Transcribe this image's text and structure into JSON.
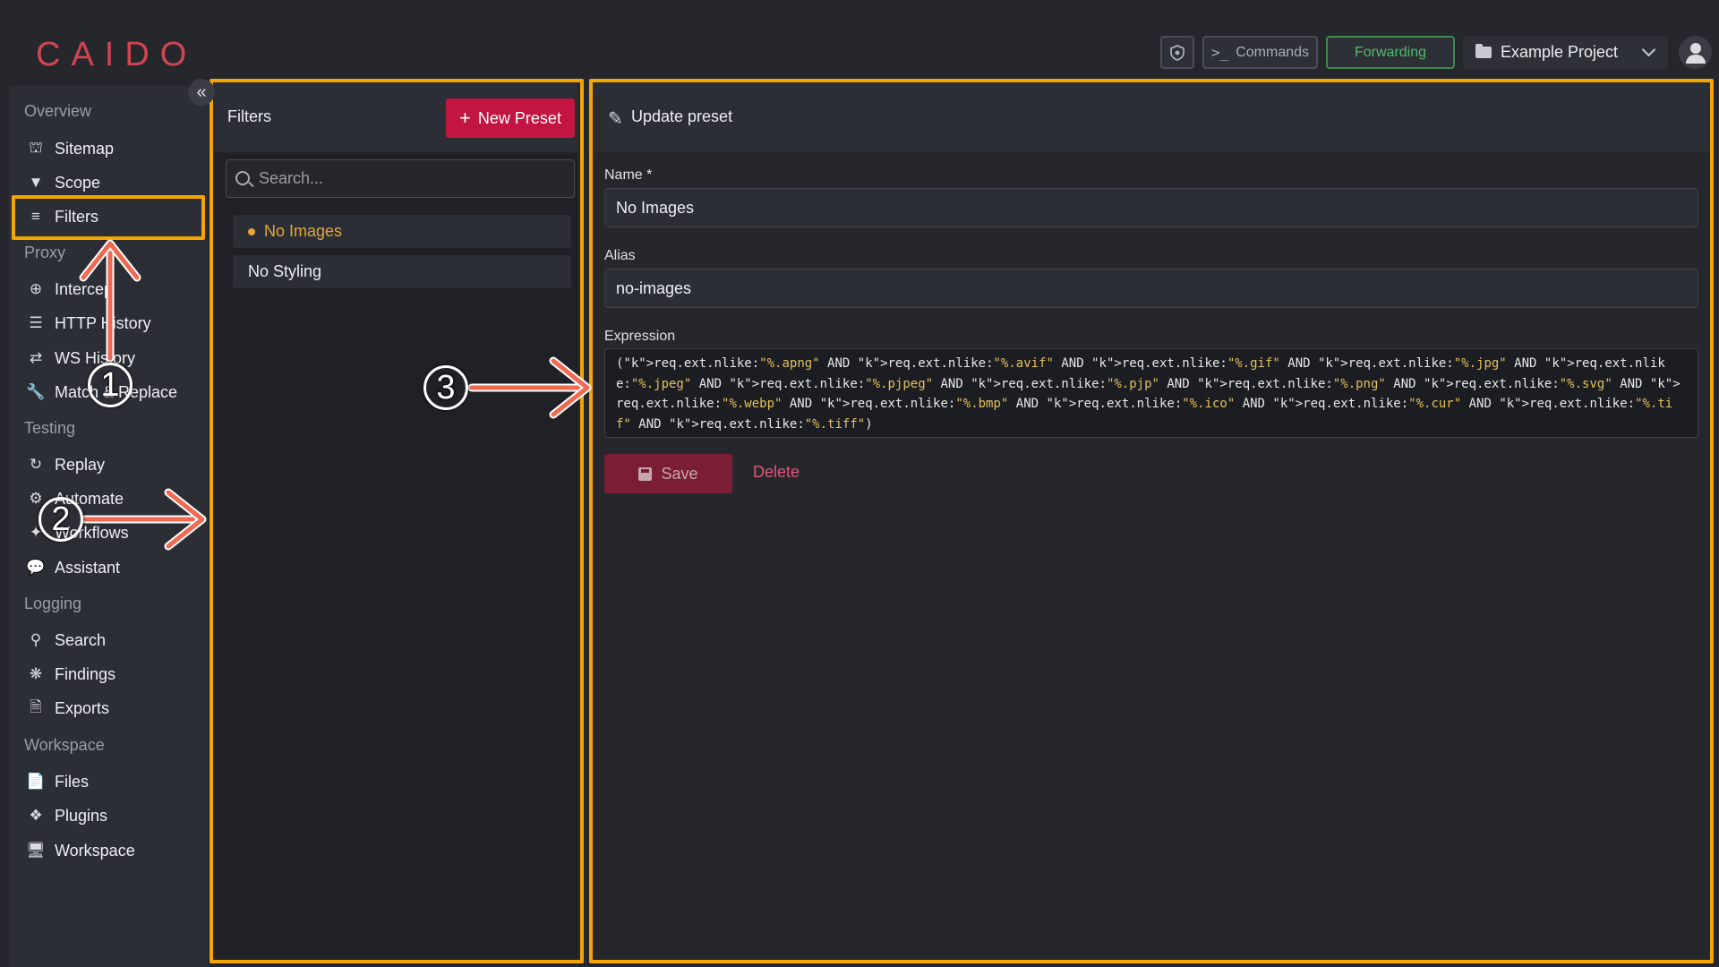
{
  "header": {
    "logo": "CAIDO",
    "commands_label": "Commands",
    "forwarding_label": "Forwarding",
    "project_name": "Example Project"
  },
  "sidebar": {
    "sections": [
      {
        "title": "Overview",
        "items": [
          "Sitemap",
          "Scope",
          "Filters"
        ]
      },
      {
        "title": "Proxy",
        "items": [
          "Intercept",
          "HTTP History",
          "WS History",
          "Match & Replace"
        ]
      },
      {
        "title": "Testing",
        "items": [
          "Replay",
          "Automate",
          "Workflows",
          "Assistant"
        ]
      },
      {
        "title": "Logging",
        "items": [
          "Search",
          "Findings",
          "Exports"
        ]
      },
      {
        "title": "Workspace",
        "items": [
          "Files",
          "Plugins",
          "Workspace"
        ]
      }
    ],
    "labels": {
      "overview": "Overview",
      "sitemap": "Sitemap",
      "scope": "Scope",
      "filters": "Filters",
      "proxy": "Proxy",
      "intercept": "Intercep",
      "http_history": "HTTP History",
      "ws_history": "WS History",
      "match_replace": "Match & Replace",
      "testing": "Testing",
      "replay": "Replay",
      "automate": "Automate",
      "workflows": "Workflows",
      "assistant": "Assistant",
      "logging": "Logging",
      "search": "Search",
      "findings": "Findings",
      "exports": "Exports",
      "workspace_section": "Workspace",
      "files": "Files",
      "plugins": "Plugins",
      "workspace": "Workspace"
    }
  },
  "filters_pane": {
    "title": "Filters",
    "new_preset_label": "New Preset",
    "search_placeholder": "Search...",
    "presets": [
      {
        "name": "No Images",
        "active": true
      },
      {
        "name": "No Styling",
        "active": false
      }
    ]
  },
  "editor": {
    "title": "Update preset",
    "name_label": "Name *",
    "name_value": "No Images",
    "alias_label": "Alias",
    "alias_value": "no-images",
    "expression_label": "Expression",
    "expression_value": "(req.ext.nlike:\"%.apng\" AND req.ext.nlike:\"%.avif\" AND req.ext.nlike:\"%.gif\" AND req.ext.nlike:\"%.jpg\" AND req.ext.nlike:\"%.jpeg\" AND req.ext.nlike:\"%.pjpeg\" AND req.ext.nlike:\"%.pjp\" AND req.ext.nlike:\"%.png\" AND req.ext.nlike:\"%.svg\" AND req.ext.nlike:\"%.webp\" AND req.ext.nlike:\"%.bmp\" AND req.ext.nlike:\"%.ico\" AND req.ext.nlike:\"%.cur\" AND req.ext.nlike:\"%.tif\" AND req.ext.nlike:\"%.tiff\")",
    "save_label": "Save",
    "delete_label": "Delete"
  },
  "annotations": {
    "step1": "1",
    "step2": "2",
    "step3": "3",
    "highlight_color": "#f5a500",
    "arrow_color": "#f06a52"
  },
  "colors": {
    "background": "#25272d",
    "brand": "#cf4552",
    "accent_button": "#c31542",
    "active_preset": "#e7a53a",
    "forwarding": "#56b96a"
  }
}
